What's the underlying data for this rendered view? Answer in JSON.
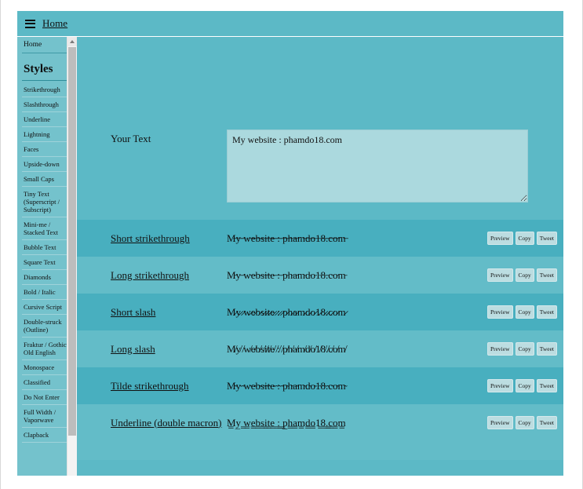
{
  "header": {
    "menu_icon": "hamburger-icon",
    "home_link": "Home"
  },
  "sidebar": {
    "home": "Home",
    "heading": "Styles",
    "items": [
      "Strikethrough",
      "Slashthrough",
      "Underline",
      "Lightning",
      "Faces",
      "Upside-down",
      "Small Caps",
      "Tiny Text (Superscript / Subscript)",
      "Mini-me / Stacked Text",
      "Bubble Text",
      "Square Text",
      "Diamonds",
      "Bold / Italic",
      "Cursive Script",
      "Double-struck (Outline)",
      "Fraktur / Gothic / Old English",
      "Monospace",
      "Classified",
      "Do Not Enter",
      "Full Width / Vaporwave",
      "Clapback"
    ],
    "scroll_up_icon": "triangle-up-icon"
  },
  "editor": {
    "label": "Your Text",
    "value": "My website : phamdo18.com",
    "placeholder": "My website : phamdo18.com"
  },
  "actions": {
    "preview": "Preview",
    "copy": "Copy",
    "tweet": "Tweet"
  },
  "rows": [
    {
      "name": "Short strikethrough",
      "output": "M̶y̶ ̶w̶e̶b̶s̶i̶t̶e̶ ̶:̶ ̶p̶h̶a̶m̶d̶o̶1̶8̶.̶c̶o̶m̶"
    },
    {
      "name": "Long strikethrough",
      "output": "M̵y̵ ̵w̵e̵b̵s̵i̵t̵e̵ ̵:̵ ̵p̵h̵a̵m̵d̵o̵1̵8̵.̵c̵o̵m̵"
    },
    {
      "name": "Short slash",
      "output": "M̷y̷ ̷w̷e̷b̷s̷i̷t̷e̷ ̷:̷ ̷p̷h̷a̷m̷d̷o̷1̷8̷.̷c̷o̷m̷"
    },
    {
      "name": "Long slash",
      "output": "M̸y̸ ̸w̸e̸b̸s̸i̸t̸e̸ ̸:̸ ̸p̸h̸a̸m̸d̸o̸1̸8̸.̸c̸o̸m̸"
    },
    {
      "name": "Tilde strikethrough",
      "output": "M̴y̴ ̴w̴e̴b̴s̴i̴t̴e̴ ̴:̴ ̴p̴h̴a̴m̴d̴o̴1̴8̴.̴c̴o̴m̴"
    },
    {
      "name": "Underline (double macron)",
      "output": "M̳y̳ ̳w̳e̳b̳s̳i̳t̳e̳ ̳:̳ ̳p̳h̳a̳m̳d̳o̳1̳8̳.̳c̳o̳m̳"
    }
  ],
  "colors": {
    "header_bg": "#5cb9c6",
    "row_odd": "#48afbf",
    "row_even": "#63bcc8",
    "sidebar_bg": "#74c2cc",
    "textarea_bg": "#abd9de"
  }
}
